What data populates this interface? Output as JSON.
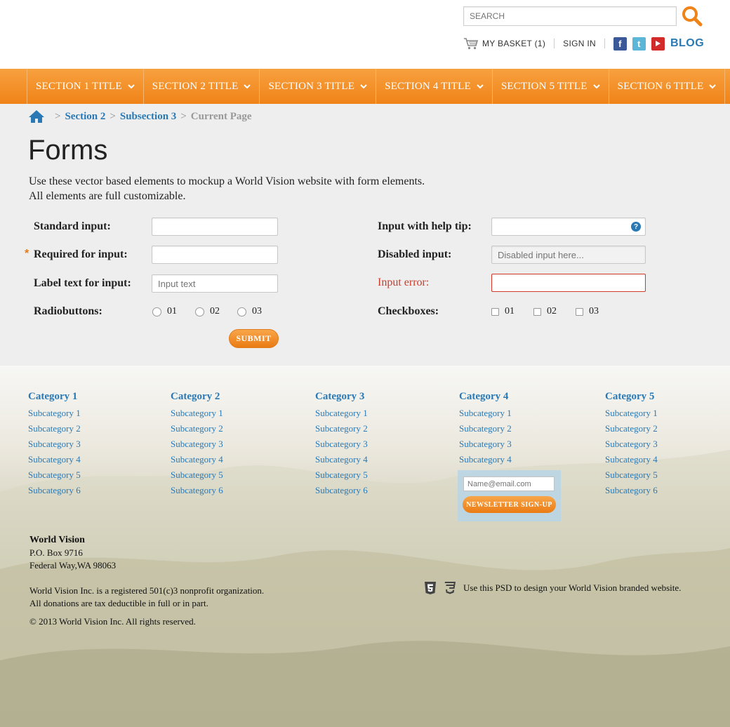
{
  "header": {
    "search_placeholder": "SEARCH",
    "basket_label": "MY BASKET (1)",
    "signin_label": "SIGN IN",
    "blog_label": "BLOG"
  },
  "nav": {
    "items": [
      {
        "label": "SECTION 1 TITLE"
      },
      {
        "label": "SECTION 2 TITLE"
      },
      {
        "label": "SECTION 3 TITLE"
      },
      {
        "label": "SECTION 4 TITLE"
      },
      {
        "label": "SECTION 5 TITLE"
      },
      {
        "label": "SECTION 6 TITLE"
      }
    ]
  },
  "breadcrumb": {
    "items": [
      "Section 2",
      "Subsection 3"
    ],
    "current": "Current Page",
    "separator": ">"
  },
  "page": {
    "title": "Forms",
    "intro_line1": "Use these vector based elements to mockup a World Vision website with form elements.",
    "intro_line2": "All elements are full customizable."
  },
  "form": {
    "standard_label": "Standard input:",
    "required_label": "Required for input:",
    "required_star": "*",
    "labeltext_label": "Label text for input:",
    "labeltext_placeholder": "Input text",
    "radio_label": "Radiobuttons:",
    "radio_options": [
      "01",
      "02",
      "03"
    ],
    "help_label": "Input with help tip:",
    "help_icon": "?",
    "disabled_label": "Disabled input:",
    "disabled_placeholder": "Disabled input here...",
    "error_label": "Input error:",
    "checkbox_label": "Checkboxes:",
    "checkbox_options": [
      "01",
      "02",
      "03"
    ],
    "submit_label": "SUBMIT"
  },
  "footer": {
    "categories": [
      {
        "title": "Category 1",
        "items": [
          "Subcategory 1",
          "Subcategory 2",
          "Subcategory 3",
          "Subcategory 4",
          "Subcategory 5",
          "Subcategory 6"
        ]
      },
      {
        "title": "Category 2",
        "items": [
          "Subcategory 1",
          "Subcategory 2",
          "Subcategory 3",
          "Subcategory 4",
          "Subcategory 5",
          "Subcategory 6"
        ]
      },
      {
        "title": "Category 3",
        "items": [
          "Subcategory 1",
          "Subcategory 2",
          "Subcategory 3",
          "Subcategory 4",
          "Subcategory 5",
          "Subcategory 6"
        ]
      },
      {
        "title": "Category 4",
        "items": [
          "Subcategory 1",
          "Subcategory 2",
          "Subcategory 3",
          "Subcategory 4"
        ]
      },
      {
        "title": "Category 5",
        "items": [
          "Subcategory 1",
          "Subcategory 2",
          "Subcategory 3",
          "Subcategory 4",
          "Subcategory 5",
          "Subcategory 6"
        ]
      }
    ],
    "newsletter_placeholder": "Name@email.com",
    "newsletter_button": "NEWSLETTER SIGN-UP",
    "org_name": "World Vision",
    "address_line1": "P.O. Box 9716",
    "address_line2": "Federal Way,WA 98063",
    "legal_line1": "World Vision Inc. is a registered 501(c)3 nonprofit organization.",
    "legal_line2": "All donations are tax deductible in full or in part.",
    "copyright": "© 2013 World Vision Inc. All rights reserved.",
    "psd_note": "Use this PSD to design your World Vision branded website."
  },
  "colors": {
    "accent_orange": "#f08318",
    "link_blue": "#2a79b5",
    "error_red": "#cc3b2a"
  }
}
